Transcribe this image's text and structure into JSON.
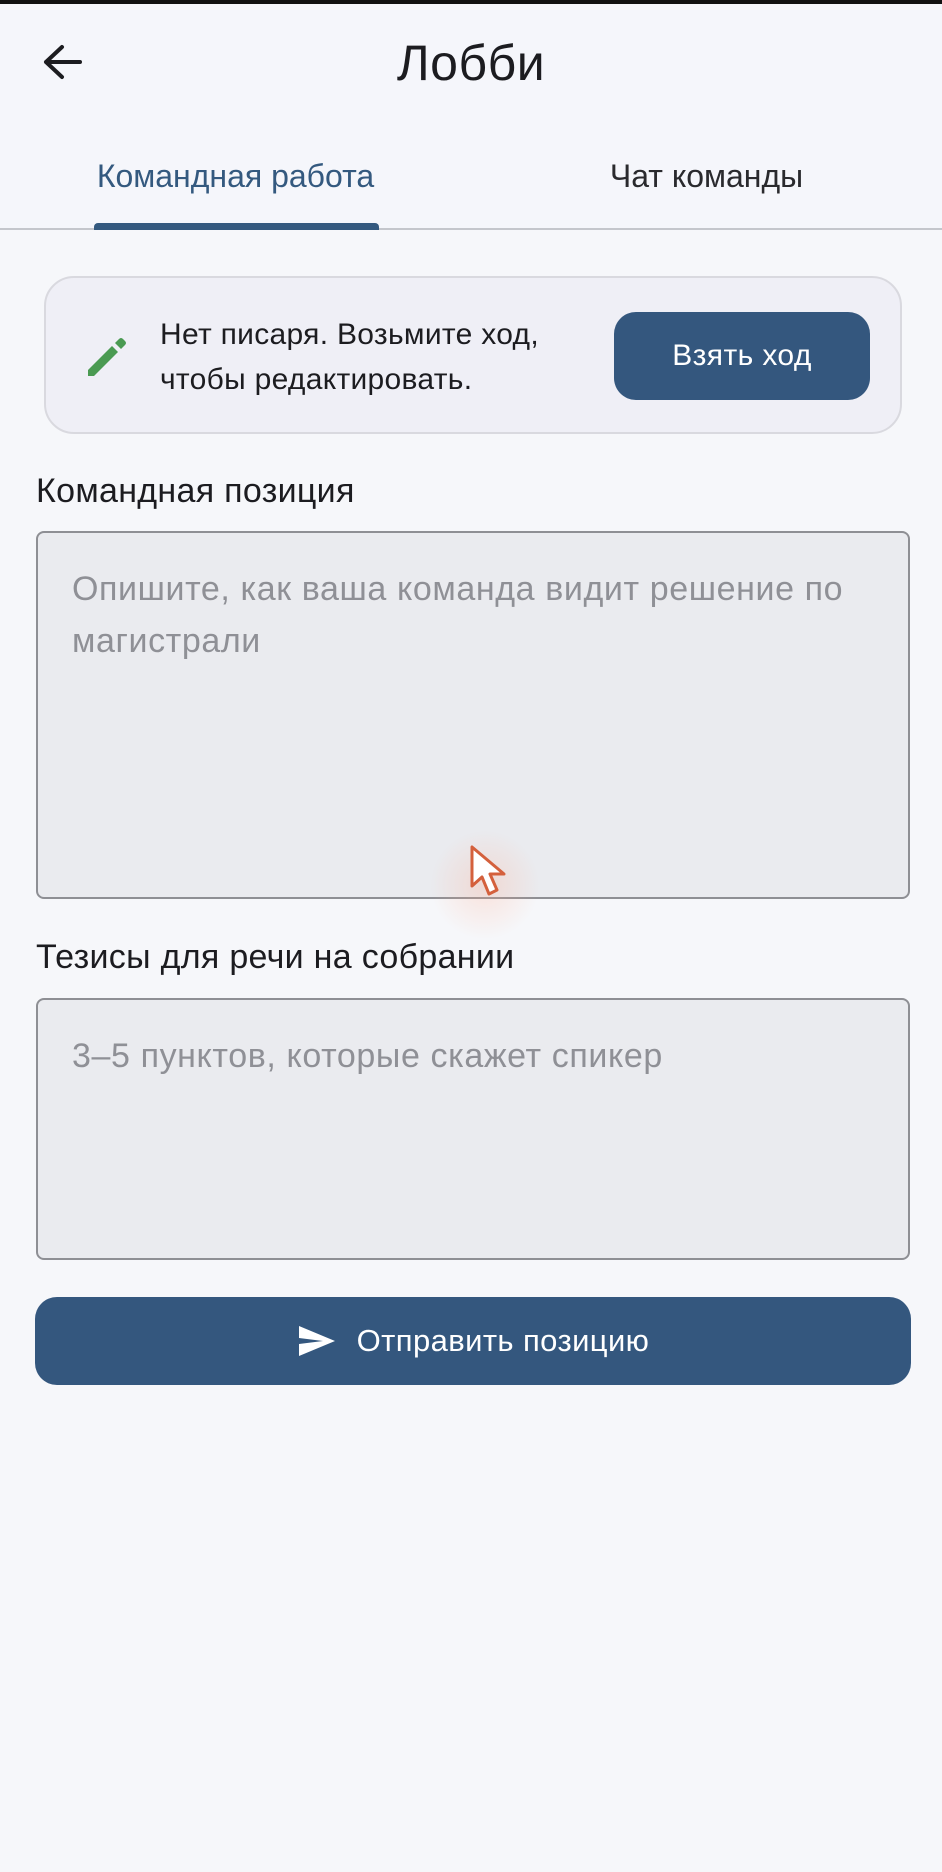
{
  "appbar": {
    "title": "Лобби",
    "back_icon": "arrow-left-icon"
  },
  "tabs": [
    {
      "label": "Командная работа",
      "selected": true
    },
    {
      "label": "Чат команды",
      "selected": false
    }
  ],
  "notice": {
    "icon": "pencil-icon",
    "text_line1": "Нет писаря. Возьмите ход,",
    "text_line2": "чтобы редактировать.",
    "button_label": "Взять ход"
  },
  "form": {
    "position_label": "Командная позиция",
    "position_placeholder": "Опишите, как ваша команда видит решение по магистрали",
    "theses_label": "Тезисы для речи на собрании",
    "theses_placeholder": "3–5 пунктов, которые скажет спикер",
    "submit_label": "Отправить позицию",
    "submit_icon": "send-icon"
  },
  "colors": {
    "primary": "#34577e",
    "accent_icon": "#4a9a52",
    "background": "#f6f7fa"
  }
}
